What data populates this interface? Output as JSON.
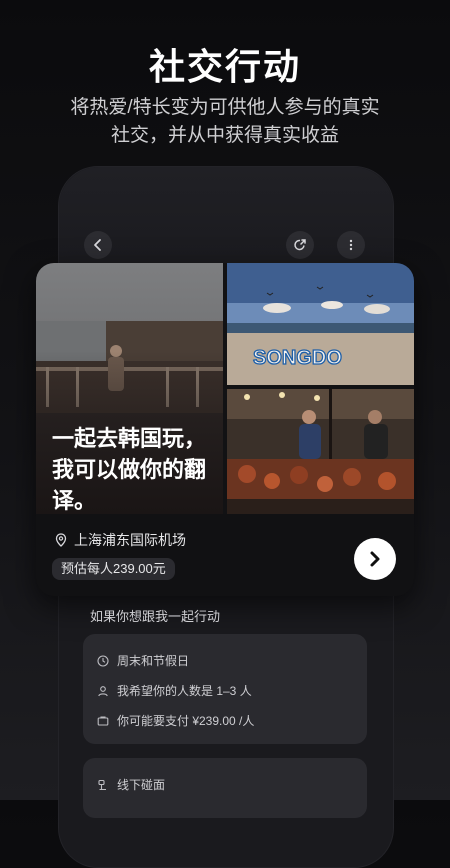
{
  "headline": "社交行动",
  "subline": [
    "将热爱/特长变为可供他人参与的真实",
    "社交，并从中获得真实收益"
  ],
  "card": {
    "overlay_text": "一起去韩国玩，我可以做你的翻译。",
    "beach_sign": "SONGDO",
    "location": "上海浦东国际机场",
    "price": "预估每人239.00元"
  },
  "detail": {
    "section_title": "如果你想跟我一起行动",
    "rows": [
      {
        "icon": "clock-icon",
        "text": "周末和节假日"
      },
      {
        "icon": "person-icon",
        "text": "我希望你的人数是 1–3 人"
      },
      {
        "icon": "wallet-icon",
        "text": "你可能要支付 ¥239.00 /人"
      }
    ],
    "meet": {
      "icon": "meet-icon",
      "text": "线下碰面"
    }
  }
}
